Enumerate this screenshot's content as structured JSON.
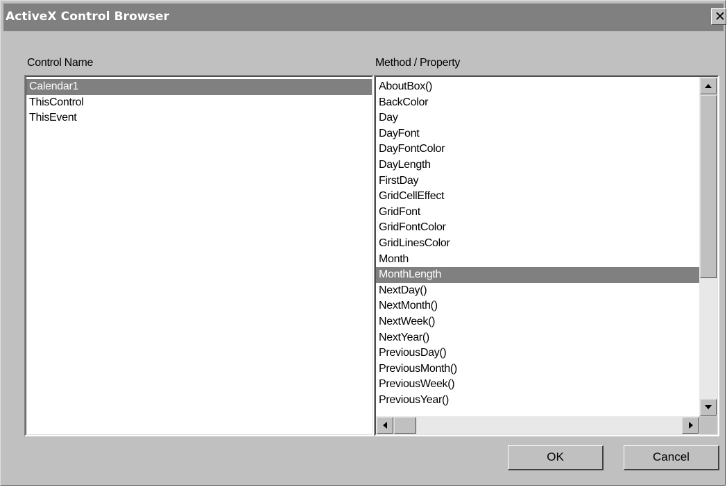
{
  "window": {
    "title": "ActiveX Control Browser",
    "close_glyph": "✕"
  },
  "controls": {
    "label": "Control Name",
    "items": [
      "Calendar1",
      "ThisControl",
      "ThisEvent"
    ],
    "selected_index": 0
  },
  "methods": {
    "label": "Method / Property",
    "items": [
      "AboutBox()",
      "BackColor",
      "Day",
      "DayFont",
      "DayFontColor",
      "DayLength",
      "FirstDay",
      "GridCellEffect",
      "GridFont",
      "GridFontColor",
      "GridLinesColor",
      "Month",
      "MonthLength",
      "NextDay()",
      "NextMonth()",
      "NextWeek()",
      "NextYear()",
      "PreviousDay()",
      "PreviousMonth()",
      "PreviousWeek()",
      "PreviousYear()"
    ],
    "selected_index": 12
  },
  "buttons": {
    "ok": "OK",
    "cancel": "Cancel"
  },
  "colors": {
    "title_bar": "#808080",
    "selection": "#808080",
    "face": "#c0c0c0"
  }
}
